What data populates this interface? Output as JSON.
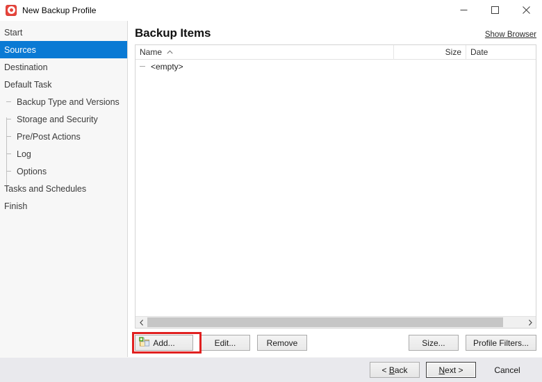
{
  "window": {
    "title": "New Backup Profile",
    "icon": "app-target-icon",
    "controls": {
      "minimize": "minimize-icon",
      "maximize": "maximize-icon",
      "close": "close-icon"
    }
  },
  "sidebar": {
    "items": [
      {
        "label": "Start",
        "level": 0,
        "selected": false
      },
      {
        "label": "Sources",
        "level": 0,
        "selected": true
      },
      {
        "label": "Destination",
        "level": 0,
        "selected": false
      },
      {
        "label": "Default Task",
        "level": 0,
        "selected": false
      },
      {
        "label": "Backup Type and Versions",
        "level": 1,
        "selected": false
      },
      {
        "label": "Storage and Security",
        "level": 1,
        "selected": false
      },
      {
        "label": "Pre/Post Actions",
        "level": 1,
        "selected": false
      },
      {
        "label": "Log",
        "level": 1,
        "selected": false
      },
      {
        "label": "Options",
        "level": 1,
        "selected": false
      },
      {
        "label": "Tasks and Schedules",
        "level": 0,
        "selected": false
      },
      {
        "label": "Finish",
        "level": 0,
        "selected": false
      }
    ],
    "selected_color": "#0a7ad4"
  },
  "main": {
    "title": "Backup Items",
    "show_browser_link": "Show Browser",
    "list": {
      "columns": {
        "name": "Name",
        "size": "Size",
        "date": "Date"
      },
      "sort_column": "Name",
      "sort_direction": "ascending",
      "rows": [
        {
          "name": "<empty>",
          "size": "",
          "date": ""
        }
      ]
    },
    "scrollbar": {
      "left_arrow": "chevron-left-icon",
      "right_arrow": "chevron-right-icon"
    }
  },
  "toolbar": {
    "add_label": "Add...",
    "edit_label": "Edit...",
    "remove_label": "Remove",
    "size_label": "Size...",
    "profile_filters_label": "Profile Filters...",
    "highlighted_button": "Add...",
    "highlight_color": "#e02020"
  },
  "footer": {
    "back_label": "< Back",
    "back_accel": "B",
    "next_label": "Next >",
    "next_accel": "N",
    "cancel_label": "Cancel",
    "focused_button": "Next >"
  }
}
